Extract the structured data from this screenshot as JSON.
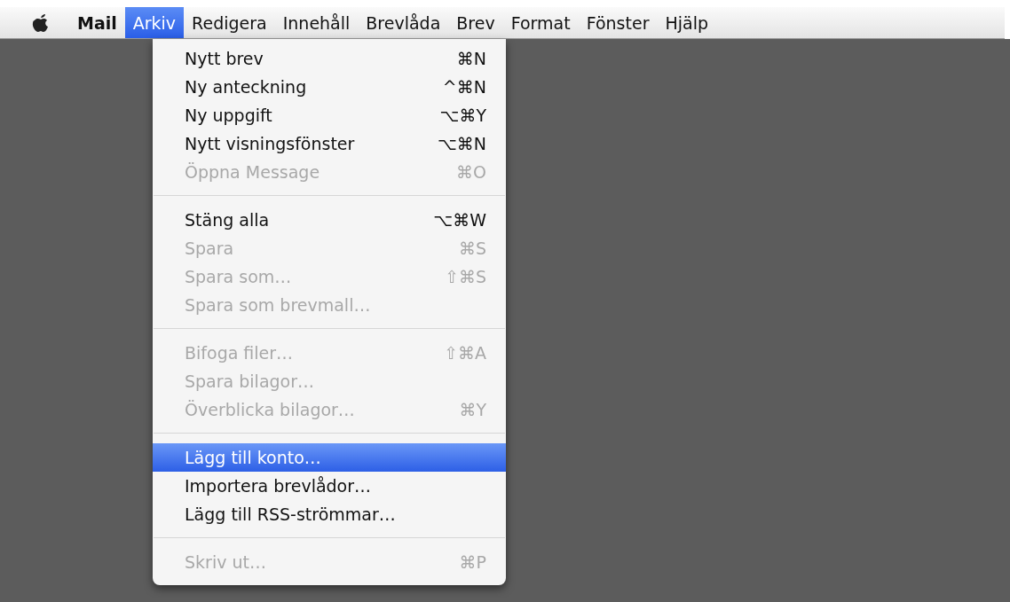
{
  "menu_bar": [
    {
      "label": "Mail",
      "selected": false,
      "bold": true
    },
    {
      "label": "Arkiv",
      "selected": true,
      "bold": false
    },
    {
      "label": "Redigera",
      "selected": false,
      "bold": false
    },
    {
      "label": "Innehåll",
      "selected": false,
      "bold": false
    },
    {
      "label": "Brevlåda",
      "selected": false,
      "bold": false
    },
    {
      "label": "Brev",
      "selected": false,
      "bold": false
    },
    {
      "label": "Format",
      "selected": false,
      "bold": false
    },
    {
      "label": "Fönster",
      "selected": false,
      "bold": false
    },
    {
      "label": "Hjälp",
      "selected": false,
      "bold": false
    }
  ],
  "menu": {
    "items": [
      {
        "kind": "item",
        "label": "Nytt brev",
        "shortcut": "⌘N",
        "disabled": false,
        "selected": false
      },
      {
        "kind": "item",
        "label": "Ny anteckning",
        "shortcut": "^⌘N",
        "disabled": false,
        "selected": false
      },
      {
        "kind": "item",
        "label": "Ny uppgift",
        "shortcut": "⌥⌘Y",
        "disabled": false,
        "selected": false
      },
      {
        "kind": "item",
        "label": "Nytt visningsfönster",
        "shortcut": "⌥⌘N",
        "disabled": false,
        "selected": false
      },
      {
        "kind": "item",
        "label": "Öppna Message",
        "shortcut": "⌘O",
        "disabled": true,
        "selected": false
      },
      {
        "kind": "separator"
      },
      {
        "kind": "item",
        "label": "Stäng alla",
        "shortcut": "⌥⌘W",
        "disabled": false,
        "selected": false
      },
      {
        "kind": "item",
        "label": "Spara",
        "shortcut": "⌘S",
        "disabled": true,
        "selected": false
      },
      {
        "kind": "item",
        "label": "Spara som…",
        "shortcut": "⇧⌘S",
        "disabled": true,
        "selected": false
      },
      {
        "kind": "item",
        "label": "Spara som brevmall…",
        "disabled": true,
        "selected": false
      },
      {
        "kind": "separator"
      },
      {
        "kind": "item",
        "label": "Bifoga filer…",
        "shortcut": "⇧⌘A",
        "disabled": true,
        "selected": false
      },
      {
        "kind": "item",
        "label": "Spara bilagor…",
        "disabled": true,
        "selected": false
      },
      {
        "kind": "item",
        "label": "Överblicka bilagor…",
        "shortcut": "⌘Y",
        "disabled": true,
        "selected": false
      },
      {
        "kind": "separator"
      },
      {
        "kind": "item",
        "label": "Lägg till konto…",
        "disabled": false,
        "selected": true
      },
      {
        "kind": "item",
        "label": "Importera brevlådor…",
        "disabled": false,
        "selected": false
      },
      {
        "kind": "item",
        "label": "Lägg till RSS-strömmar…",
        "disabled": false,
        "selected": false
      },
      {
        "kind": "separator"
      },
      {
        "kind": "item",
        "label": "Skriv ut…",
        "shortcut": "⌘P",
        "disabled": true,
        "selected": false
      }
    ]
  }
}
